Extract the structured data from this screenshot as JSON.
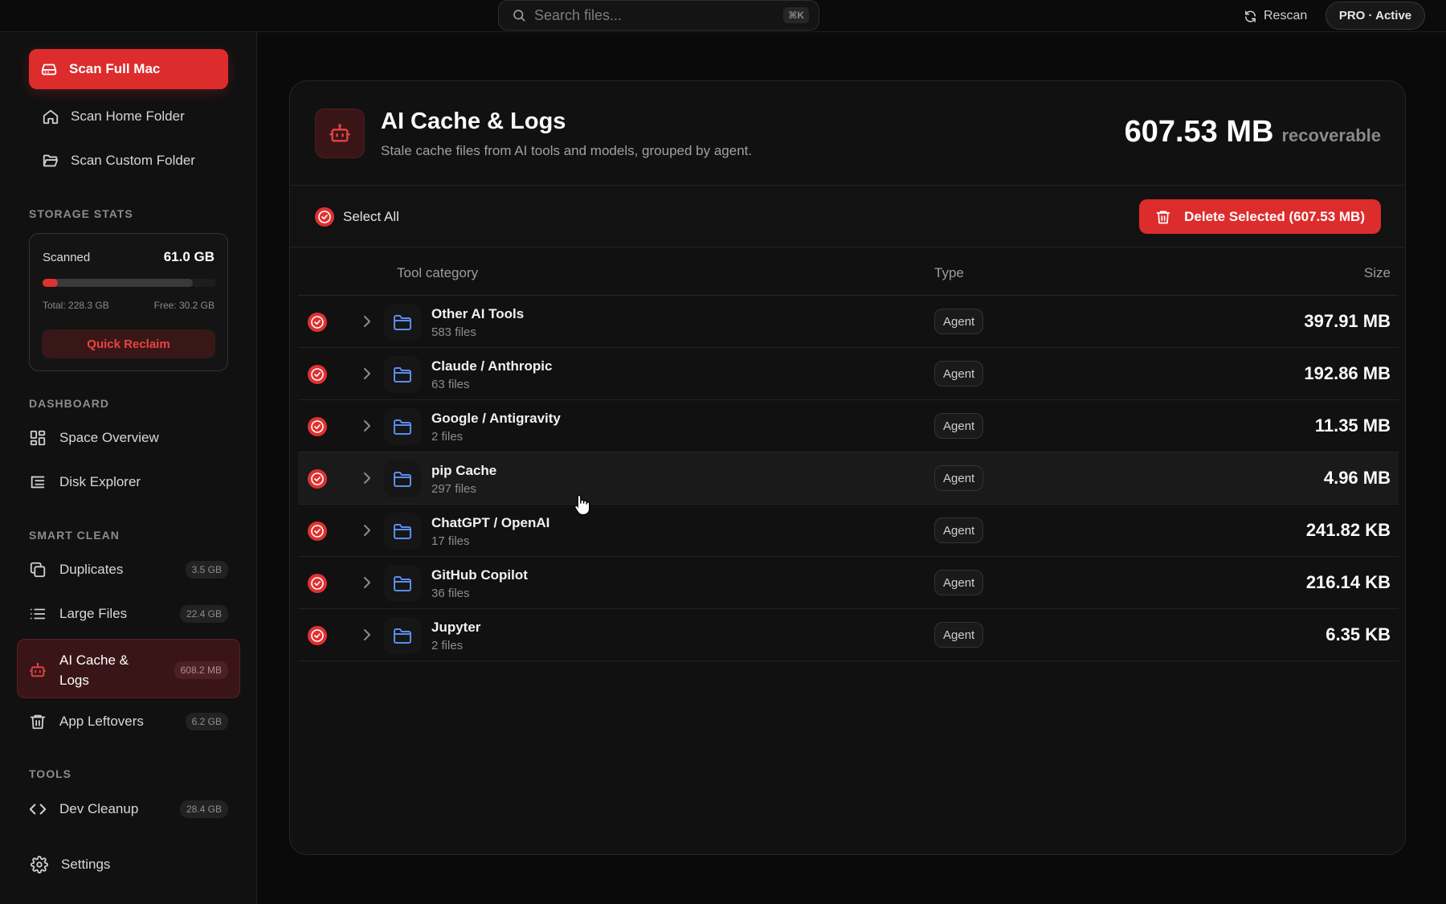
{
  "topbar": {
    "search_placeholder": "Search files...",
    "shortcut": "⌘K",
    "rescan_label": "Rescan",
    "plan_badge": "PRO · Active"
  },
  "sidebar": {
    "scan_full": "Scan Full Mac",
    "scan_home": "Scan Home Folder",
    "scan_custom": "Scan Custom Folder",
    "storage_title": "STORAGE STATS",
    "storage": {
      "scanned_label": "Scanned",
      "scanned_value": "61.0 GB",
      "total": "Total: 228.3 GB",
      "free": "Free: 30.2 GB",
      "used_fraction": 0.868,
      "scanned_fraction": 0.09,
      "quick_reclaim": "Quick Reclaim"
    },
    "dashboard_title": "DASHBOARD",
    "dashboard_items": [
      {
        "label": "Space Overview",
        "icon": "grid-icon"
      },
      {
        "label": "Disk Explorer",
        "icon": "tree-list-icon"
      }
    ],
    "smart_clean_title": "SMART CLEAN",
    "smart_clean_items": [
      {
        "label": "Duplicates",
        "badge": "3.5 GB",
        "icon": "copy-icon"
      },
      {
        "label": "Large Files",
        "badge": "22.4 GB",
        "icon": "list-icon"
      },
      {
        "label": "AI Cache &\nLogs",
        "badge": "608.2 MB",
        "icon": "robot-icon",
        "active": true
      },
      {
        "label": "App Leftovers",
        "badge": "6.2 GB",
        "icon": "trash-icon"
      }
    ],
    "tools_title": "TOOLS",
    "tools_items": [
      {
        "label": "Dev Cleanup",
        "badge": "28.4 GB",
        "icon": "code-icon"
      }
    ],
    "settings_label": "Settings"
  },
  "main": {
    "title": "AI Cache & Logs",
    "subtitle": "Stale cache files from AI tools and models, grouped by agent.",
    "recoverable_size": "607.53 MB",
    "recoverable_label": "recoverable",
    "select_all": "Select All",
    "delete_button": "Delete Selected (607.53 MB)",
    "columns": {
      "category": "Tool category",
      "type": "Type",
      "size": "Size"
    },
    "rows": [
      {
        "name": "Other AI Tools",
        "files": "583 files",
        "type": "Agent",
        "size": "397.91 MB"
      },
      {
        "name": "Claude / Anthropic",
        "files": "63 files",
        "type": "Agent",
        "size": "192.86 MB"
      },
      {
        "name": "Google / Antigravity",
        "files": "2 files",
        "type": "Agent",
        "size": "11.35 MB"
      },
      {
        "name": "pip Cache",
        "files": "297 files",
        "type": "Agent",
        "size": "4.96 MB"
      },
      {
        "name": "ChatGPT / OpenAI",
        "files": "17 files",
        "type": "Agent",
        "size": "241.82 KB"
      },
      {
        "name": "GitHub Copilot",
        "files": "36 files",
        "type": "Agent",
        "size": "216.14 KB"
      },
      {
        "name": "Jupyter",
        "files": "2 files",
        "type": "Agent",
        "size": "6.35 KB"
      }
    ]
  },
  "colors": {
    "accent": "#dd2c2c",
    "folder": "#5b8def",
    "background": "#0a0a0a"
  }
}
